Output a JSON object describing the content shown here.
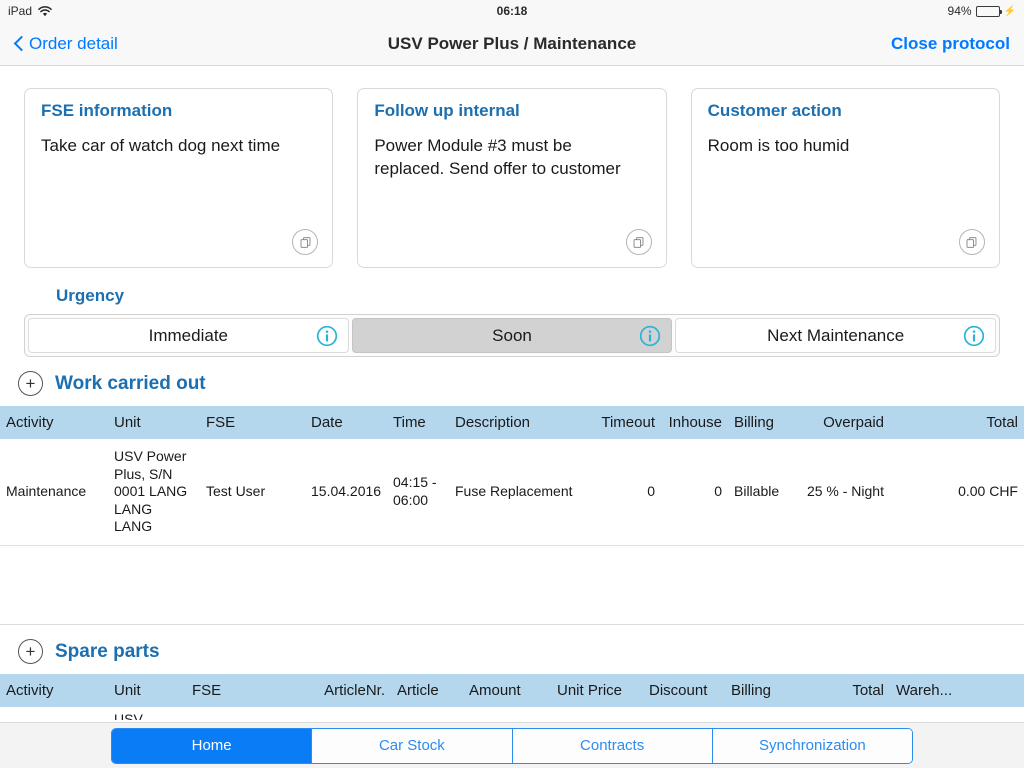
{
  "status_bar": {
    "device": "iPad",
    "wifi_icon": "wifi-icon",
    "time": "06:18",
    "battery_percent": "94%",
    "battery_icon": "battery-icon",
    "charging_icon": "charging-bolt-icon"
  },
  "nav": {
    "back_label": "Order detail",
    "back_icon": "chevron-left-icon",
    "title": "USV Power Plus / Maintenance",
    "close_label": "Close protocol"
  },
  "cards": [
    {
      "title": "FSE information",
      "body": "Take car of watch dog next time",
      "copy_icon": "copy-icon"
    },
    {
      "title": "Follow up internal",
      "body": "Power Module #3 must be replaced. Send offer to customer",
      "copy_icon": "copy-icon"
    },
    {
      "title": "Customer action",
      "body": "Room is too humid",
      "copy_icon": "copy-icon"
    }
  ],
  "urgency": {
    "label": "Urgency",
    "options": [
      {
        "label": "Immediate",
        "selected": false,
        "info_icon": "info-circle-icon"
      },
      {
        "label": "Soon",
        "selected": true,
        "info_icon": "info-circle-icon"
      },
      {
        "label": "Next Maintenance",
        "selected": false,
        "info_icon": "info-circle-icon"
      }
    ]
  },
  "work_carried_out": {
    "title": "Work carried out",
    "add_icon": "plus-circle-icon",
    "columns": [
      "Activity",
      "Unit",
      "FSE",
      "Date",
      "Time",
      "Description",
      "Timeout",
      "Inhouse",
      "Billing",
      "Overpaid",
      "Total"
    ],
    "rows": [
      {
        "activity": "Maintenance",
        "unit": "USV Power Plus, S/N 0001 LANG LANG LANG",
        "fse": "Test User",
        "date": "15.04.2016",
        "time": "04:15 - 06:00",
        "description": "Fuse Replacement",
        "timeout": "0",
        "inhouse": "0",
        "billing": "Billable",
        "overpaid": "25 % - Night",
        "total": "0.00 CHF"
      }
    ]
  },
  "spare_parts": {
    "title": "Spare parts",
    "add_icon": "plus-circle-icon",
    "columns": [
      "Activity",
      "Unit",
      "FSE",
      "ArticleNr.",
      "Article",
      "Amount",
      "Unit Price",
      "Discount",
      "Billing",
      "Total",
      "Wareh..."
    ],
    "rows": [
      {
        "activity": "",
        "unit": "USV",
        "fse": "",
        "article_nr": "",
        "article": "",
        "amount": "",
        "unit_price": "",
        "discount": "",
        "billing": "",
        "total": "",
        "warehouse": ""
      }
    ]
  },
  "tab_bar": {
    "items": [
      {
        "label": "Home",
        "active": true
      },
      {
        "label": "Car Stock",
        "active": false
      },
      {
        "label": "Contracts",
        "active": false
      },
      {
        "label": "Synchronization",
        "active": false
      }
    ]
  },
  "colors": {
    "accent_blue": "#1c6fb0",
    "link_blue": "#007aff",
    "tab_blue": "#0a7cf5",
    "table_header": "#b5d7ee",
    "info_icon": "#27b4d6",
    "battery_green": "#4cd964"
  }
}
